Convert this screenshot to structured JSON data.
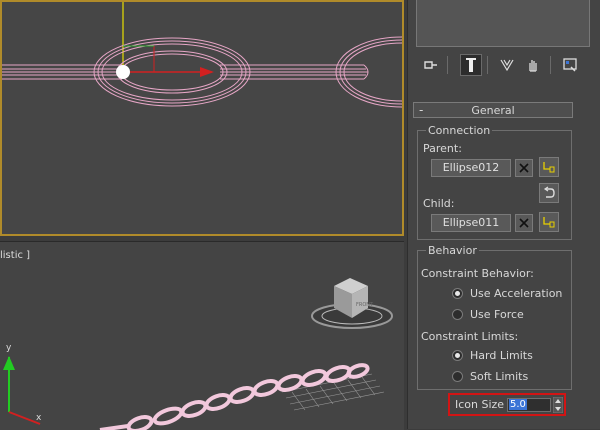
{
  "viewports": {
    "perspective_label": "listic ]"
  },
  "panel": {
    "tabs": [
      {
        "name": "create-tab-icon",
        "active": false
      },
      {
        "name": "modify-tab-icon",
        "active": true
      },
      {
        "name": "hierarchy-tab-icon",
        "active": false
      },
      {
        "name": "motion-tab-icon",
        "active": false
      },
      {
        "name": "utilities-tab-icon",
        "active": false
      }
    ],
    "rollout": {
      "collapse_symbol": "-",
      "title": "General",
      "connection": {
        "title": "Connection",
        "parent_label": "Parent:",
        "parent_value": "Ellipse012",
        "child_label": "Child:",
        "child_value": "Ellipse011"
      },
      "behavior": {
        "title": "Behavior",
        "constraint_behavior_label": "Constraint Behavior:",
        "use_acceleration": "Use Acceleration",
        "use_force": "Use Force",
        "constraint_limits_label": "Constraint Limits:",
        "hard_limits": "Hard Limits",
        "soft_limits": "Soft Limits",
        "selected_behavior": "Use Acceleration",
        "selected_limits": "Hard Limits"
      },
      "icon_size": {
        "label": "Icon Size",
        "value": "5.0"
      }
    }
  },
  "colors": {
    "chain_wire": "#e6a6c6",
    "highlight_border": "#d21414",
    "active_viewport_border": "#b08b2a",
    "selection_blue": "#3b74d6"
  }
}
